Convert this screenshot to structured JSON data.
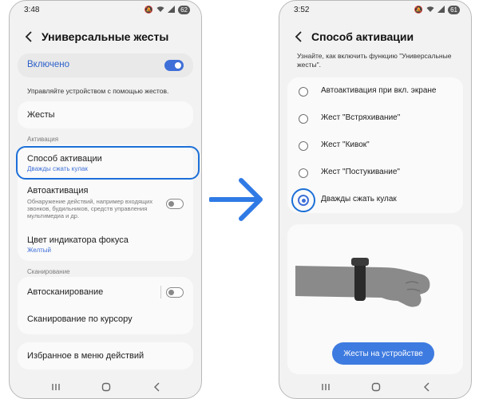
{
  "left_phone": {
    "status": {
      "time": "3:48",
      "battery": "62"
    },
    "header": {
      "title": "Универсальные жесты"
    },
    "master": {
      "label": "Включено",
      "enabled": true
    },
    "description": "Управляйте устройством с помощью жестов.",
    "gestures_row": {
      "label": "Жесты"
    },
    "section_activation": "Активация",
    "activation_method": {
      "title": "Способ активации",
      "value": "Дважды сжать кулак"
    },
    "auto_activation": {
      "title": "Автоактивация",
      "description": "Обнаружение действий, например входящих звонков, будильников, средств управления мультимедиа и др.",
      "enabled": false
    },
    "focus_color": {
      "title": "Цвет индикатора фокуса",
      "value": "Желтый"
    },
    "section_scanning": "Сканирование",
    "auto_scanning": {
      "title": "Автосканирование",
      "enabled": false
    },
    "cursor_scanning": {
      "title": "Сканирование по курсору"
    },
    "favorites": {
      "title": "Избранное в меню действий"
    }
  },
  "arrow": {
    "icon": "arrow-right-icon",
    "color": "#2f7ae5"
  },
  "right_phone": {
    "status": {
      "time": "3:52",
      "battery": "61"
    },
    "header": {
      "title": "Способ активации"
    },
    "description": "Узнайте, как включить функцию \"Универсальные жесты\".",
    "options": [
      {
        "label": "Автоактивация при вкл. экране",
        "selected": false
      },
      {
        "label": "Жест \"Встряхивание\"",
        "selected": false
      },
      {
        "label": "Жест \"Кивок\"",
        "selected": false
      },
      {
        "label": "Жест \"Постукивание\"",
        "selected": false
      },
      {
        "label": "Дважды сжать кулак",
        "selected": true
      }
    ],
    "illustration": "fist-gesture-illustration",
    "button_label": "Жесты на устройстве"
  },
  "colors": {
    "accent": "#3e6fd8",
    "highlight": "#1c6fd8",
    "phone_bg": "#f2f2f2",
    "card_bg": "#fafafa"
  }
}
